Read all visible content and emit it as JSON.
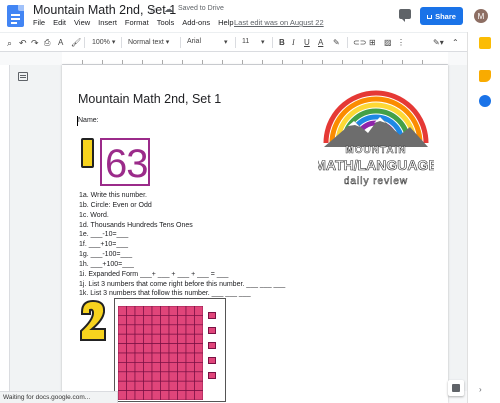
{
  "app": {
    "doc_title": "Mountain Math 2nd, Set 1",
    "saved_status": "Saved to Drive",
    "menus": [
      "File",
      "Edit",
      "View",
      "Insert",
      "Format",
      "Tools",
      "Add-ons",
      "Help"
    ],
    "last_edit": "Last edit was on August 22",
    "share_label": "Share",
    "avatar_initial": "M"
  },
  "toolbar": {
    "zoom": "100%",
    "style": "Normal text",
    "font": "Arial",
    "size": "11"
  },
  "document": {
    "title": "Mountain Math 2nd, Set 1",
    "name_label": "Name:",
    "number": "63",
    "questions": [
      "1a. Write this number.",
      "1b. Circle: Even or Odd",
      "1c. Word.",
      "1d. Thousands Hundreds Tens Ones",
      "1e. ___-10=___",
      "1f. ___+10=___",
      "1g. ___-100=___",
      "1h. ___+100=___",
      "1i. Expanded Form ___+ ___ + ___ + ___ = ___",
      "1j. List 3 numbers that come right before this number. ___ ___ ___",
      "1k. List 3 numbers that follow this number. ___ ___ ___"
    ],
    "logo": {
      "line1": "MOUNTAIN",
      "line2": "MATH/LANGUAGE",
      "line3": "daily review"
    }
  },
  "status_bar": "Waiting for docs.google.com...",
  "colors": {
    "share_blue": "#1a73e8",
    "number_purple": "#9b2b8a",
    "badge_yellow": "#f7d31e",
    "block_pink": "#e0457a"
  }
}
